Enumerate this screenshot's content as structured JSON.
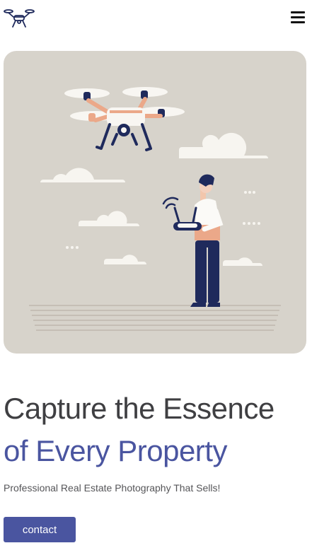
{
  "header": {
    "logo_icon": "drone-logo-icon",
    "menu_icon": "hamburger-menu-icon"
  },
  "hero": {
    "illustration": "person-flying-drone-illustration",
    "headline_line1": "Capture the Essence",
    "headline_line2": "of Every Property",
    "subtitle": "Professional Real Estate Photography That Sells!",
    "cta_label": "contact"
  },
  "colors": {
    "accent": "#4a55a0",
    "headline_dark": "#3f3f42",
    "image_background": "#d7d3cb",
    "drone_navy": "#1f2a5c",
    "accent_peach": "#eba889"
  }
}
